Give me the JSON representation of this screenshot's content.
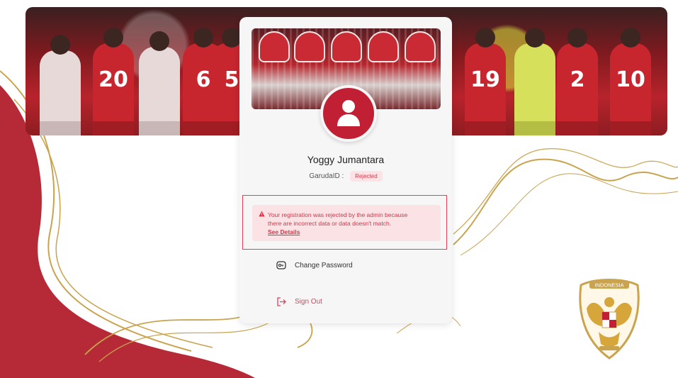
{
  "colors": {
    "brand_red": "#c11f33",
    "danger": "#e0405a",
    "alert_bg": "#fbe2e5",
    "gold": "#c9a34e"
  },
  "profile": {
    "name": "Yoggy Jumantara",
    "garuda_label": "GarudaID :",
    "status_badge": "Rejected"
  },
  "alert": {
    "icon": "warning-icon",
    "line1": "Your registration was rejected by the admin because",
    "line2": "there are incorrect data or data doesn't match.",
    "link": "See Details"
  },
  "menu": {
    "change_password": {
      "label": "Change Password",
      "icon": "key-icon"
    },
    "sign_out": {
      "label": "Sign Out",
      "icon": "logout-icon"
    }
  },
  "hero": {
    "jersey_numbers": [
      "20",
      "6",
      "5",
      "19",
      "2",
      "10"
    ]
  },
  "emblem": {
    "top_text": "INDONESIA"
  }
}
